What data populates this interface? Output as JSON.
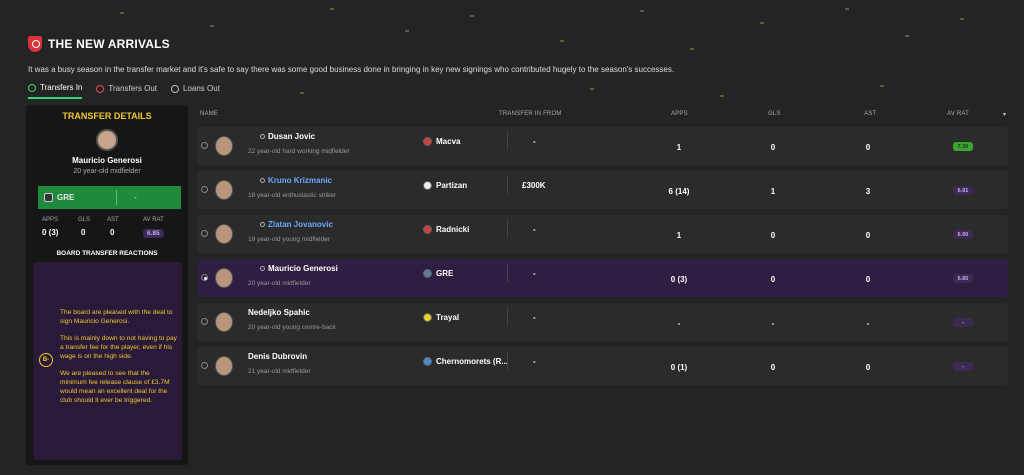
{
  "header": {
    "title": "THE NEW ARRIVALS"
  },
  "intro": "It was a busy season in the transfer market and it's safe to say there was some good business done in bringing in key new signings who contributed hugely to the season's successes.",
  "tabs": [
    {
      "label": "Transfers In"
    },
    {
      "label": "Transfers Out"
    },
    {
      "label": "Loans Out"
    }
  ],
  "panel": {
    "title": "TRANSFER DETAILS",
    "player": "Mauricio Generosi",
    "desc": "20 year-old midfielder",
    "club": "GRE",
    "fee": "-",
    "stats_labels": [
      "APPS",
      "GLS",
      "AST",
      "AV RAT"
    ],
    "stats_values": [
      "0 (3)",
      "0",
      "0",
      "6.85"
    ],
    "reactions_title": "BOARD TRANSFER REACTIONS",
    "grade": "B-",
    "reactions": [
      "The board are pleased with the deal to sign Mauricio Generosi.",
      "This is mainly down to not having to pay a transfer fee for the player, even if his wage is on the high side.",
      "We are pleased to see that the minimum fee release clause of £3.7M would mean an excellent deal for the club should it ever be triggered."
    ]
  },
  "columns": [
    "NAME",
    "TRANSFER IN FROM",
    "APPS",
    "GLS",
    "AST",
    "AV RAT"
  ],
  "rows": [
    {
      "name": "Dusan Jovic",
      "desc": "22 year-old hard working midfielder",
      "club": "Macva",
      "fee": "-",
      "apps": "1",
      "gls": "0",
      "ast": "0",
      "rat": "7.30",
      "rat_color": "green"
    },
    {
      "name": "Kruno Krizmanic",
      "desc": "18 year-old enthusiastic striker",
      "club": "Partizan",
      "fee": "£300K",
      "apps": "6 (14)",
      "gls": "1",
      "ast": "3",
      "rat": "6.91",
      "rat_color": "purple"
    },
    {
      "name": "Zlatan Jovanovic",
      "desc": "19 year-old young midfielder",
      "club": "Radnicki",
      "fee": "-",
      "apps": "1",
      "gls": "0",
      "ast": "0",
      "rat": "6.90",
      "rat_color": "purple"
    },
    {
      "name": "Mauricio Generosi",
      "desc": "20 year-old midfielder",
      "club": "GRE",
      "fee": "-",
      "apps": "0 (3)",
      "gls": "0",
      "ast": "0",
      "rat": "6.85",
      "rat_color": "purple"
    },
    {
      "name": "Nedeljko Spahic",
      "desc": "20 year-old young centre-back",
      "club": "Trayal",
      "fee": "-",
      "apps": "-",
      "gls": "-",
      "ast": "-",
      "rat": "-",
      "rat_color": "purple"
    },
    {
      "name": "Denis Dubrovin",
      "desc": "21 year-old midfielder",
      "club": "Chernomorets (R...",
      "fee": "-",
      "apps": "0 (1)",
      "gls": "0",
      "ast": "0",
      "rat": "-",
      "rat_color": "purple"
    }
  ],
  "colors": {
    "accent": "#f0c830",
    "green": "#1f8a3c",
    "selected": "#2e1e42"
  }
}
